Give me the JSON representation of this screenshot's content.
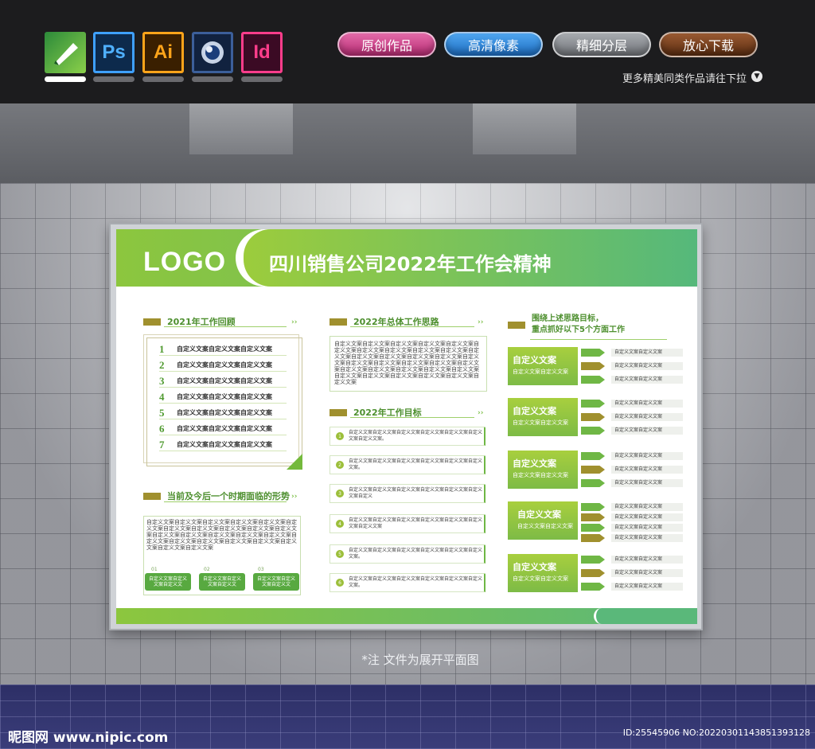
{
  "apps": [
    {
      "name": "coreldraw-icon",
      "label": ""
    },
    {
      "name": "photoshop-icon",
      "label": "Ps"
    },
    {
      "name": "illustrator-icon",
      "label": "Ai"
    },
    {
      "name": "cinema4d-icon",
      "label": ""
    },
    {
      "name": "indesign-icon",
      "label": "Id"
    }
  ],
  "pills": [
    "原创作品",
    "高清像素",
    "精细分层",
    "放心下载"
  ],
  "more_link": "更多精美同类作品请往下拉",
  "poster": {
    "logo": "LOGO",
    "title": "四川销售公司2022年工作会精神",
    "review_title": "2021年工作回顾",
    "review_items": [
      {
        "num": "1",
        "text": "自定义文案自定义文案自定义文案"
      },
      {
        "num": "2",
        "text": "自定义文案自定义文案自定义文案"
      },
      {
        "num": "3",
        "text": "自定义文案自定义文案自定义文案"
      },
      {
        "num": "4",
        "text": "自定义文案自定义文案自定义文案"
      },
      {
        "num": "5",
        "text": "自定义文案自定义文案自定义文案"
      },
      {
        "num": "6",
        "text": "自定义文案自定义文案自定义文案"
      },
      {
        "num": "7",
        "text": "自定义文案自定义文案自定义文案"
      }
    ],
    "situation_title": "当前及今后一个时期面临的形势",
    "situation_text": "自定义文案自定义文案自定义文案自定义文案自定义文案自定义文案自定义文案自定义文案自定义文案自定义文案自定义文案自定义文案自定义文案自定义文案自定义文案自定义文案自定义文案自定义文案自定义文案自定义文案自定义文案自定义文案自定义文案自定义文案",
    "situation_tags": [
      {
        "num": "01",
        "text": "自定义文案自定义文案自定义文"
      },
      {
        "num": "02",
        "text": "自定义文案自定义文案自定义文"
      },
      {
        "num": "03",
        "text": "自定义文案自定义文案自定义文"
      }
    ],
    "plan_title": "2022年总体工作思路",
    "plan_text": "自定义文案自定义文案自定义文案自定义文案自定义文案自定义文案自定义文案自定义文案自定义文案自定义文案自定义文案自定义文案自定义文案自定义文案自定义文案自定义文案自定义文案自定义文案自定义文案自定义文案自定义文案自定义文案自定义文案自定义文案自定义文案自定义文案自定义文案自定义文案自定义文案自定义文案自定义文案自定义文案",
    "goals_title": "2022年工作目标",
    "goals": [
      {
        "num": "1",
        "text": "自定义文案自定义文案自定义文案自定义文案自定义文案自定义文案自定义文案。"
      },
      {
        "num": "2",
        "text": "自定义文案自定义文案自定义文案自定义文案自定义文案自定义文案。"
      },
      {
        "num": "3",
        "text": "自定义文案自定义文案自定义文案自定义文案自定义文案自定义文案自定义"
      },
      {
        "num": "4",
        "text": "自定义文案自定义文案自定义文案自定义文案自定义文案自定义文案自定义文案"
      },
      {
        "num": "5",
        "text": "自定义文案自定义文案自定义文案自定义文案自定义文案自定义文案。"
      },
      {
        "num": "6",
        "text": "自定义文案自定义文案自定义文案自定义文案自定义文案自定义文案。"
      }
    ],
    "focus_title_1": "围绕上述思路目标，",
    "focus_title_2": "重点抓好以下5个方面工作",
    "blocks": [
      {
        "title": "自定义文案",
        "sub": "自定义文案自定义文案",
        "rows": [
          "自定义文案自定义文案",
          "自定义文案自定义文案",
          "自定义文案自定义文案"
        ]
      },
      {
        "title": "自定义文案",
        "sub": "自定义文案自定义文案",
        "rows": [
          "自定义文案自定义文案",
          "自定义文案自定义文案",
          "自定义文案自定义文案"
        ]
      },
      {
        "title": "自定义文案",
        "sub": "自定义文案自定义文案",
        "rows": [
          "自定义文案自定义文案",
          "自定义文案自定义文案",
          "自定义文案自定义文案"
        ]
      },
      {
        "title": "自定义文案",
        "sub": "自定义文案自定义文案",
        "rows": [
          "自定义文案自定义文案",
          "自定义文案自定义文案",
          "自定义文案自定义文案",
          "自定义文案自定义文案"
        ]
      },
      {
        "title": "自定义文案",
        "sub": "自定义文案自定义文案",
        "rows": [
          "自定义文案自定义文案",
          "自定义文案自定义文案",
          "自定义文案自定义文案"
        ]
      }
    ],
    "arrows_glyph": "››"
  },
  "note": "*注  文件为展开平面图",
  "watermark_left": "昵图网 www.nipic.com",
  "watermark_right": "ID:25545906 NO:20220301143851393128",
  "colors": {
    "green": "#8cc63e",
    "teal": "#5ab87a",
    "olive": "#a0902e",
    "pink": "#c2387e",
    "blue": "#1e78c8",
    "gray": "#7a7d82",
    "brown": "#6b3a1e"
  }
}
